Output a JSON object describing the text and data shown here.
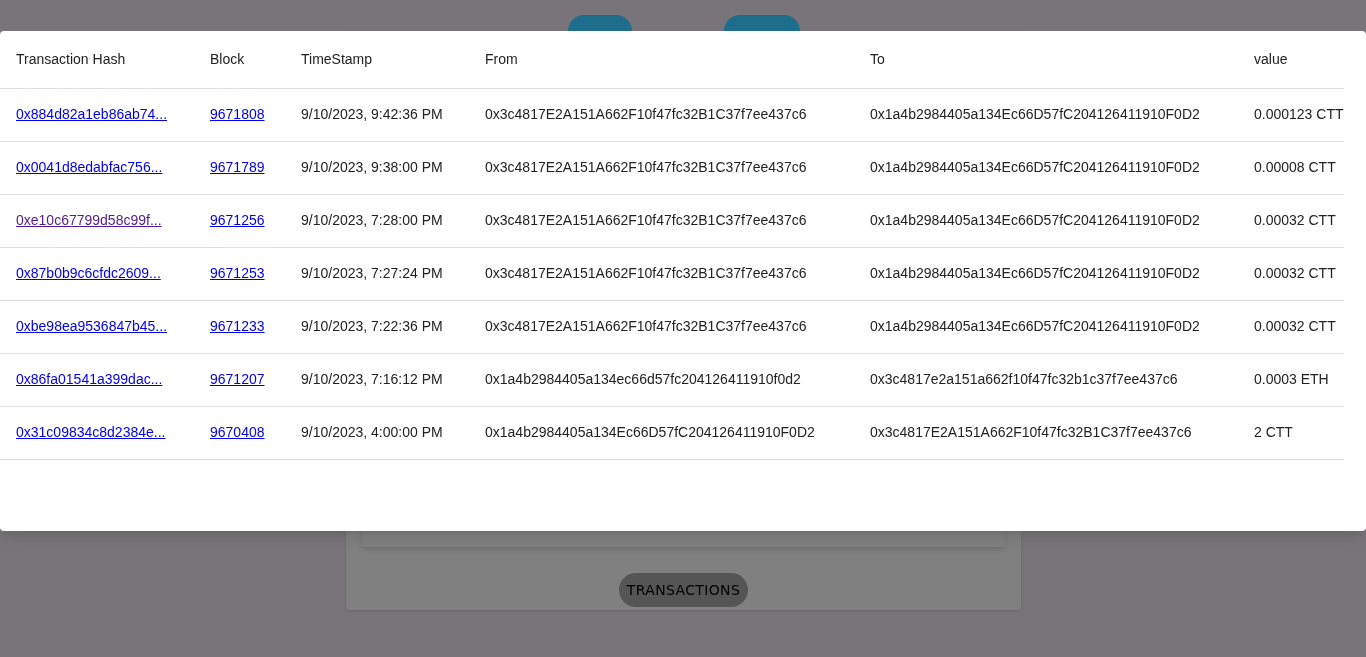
{
  "nav_buttons": [
    {
      "kind": "pill"
    },
    {
      "kind": "pill"
    }
  ],
  "table": {
    "columns": [
      "Transaction Hash",
      "Block",
      "TimeStamp",
      "From",
      "To",
      "value"
    ],
    "rows": [
      {
        "hash": "0x884d82a1eb86ab74...",
        "visited": false,
        "block": "9671808",
        "timestamp": "9/10/2023, 9:42:36 PM",
        "from": "0x3c4817E2A151A662F10f47fc32B1C37f7ee437c6",
        "to": "0x1a4b2984405a134Ec66D57fC204126411910F0D2",
        "value": "0.000123 CTT"
      },
      {
        "hash": "0x0041d8edabfac756...",
        "visited": false,
        "block": "9671789",
        "timestamp": "9/10/2023, 9:38:00 PM",
        "from": "0x3c4817E2A151A662F10f47fc32B1C37f7ee437c6",
        "to": "0x1a4b2984405a134Ec66D57fC204126411910F0D2",
        "value": "0.00008 CTT"
      },
      {
        "hash": "0xe10c67799d58c99f...",
        "visited": true,
        "block": "9671256",
        "timestamp": "9/10/2023, 7:28:00 PM",
        "from": "0x3c4817E2A151A662F10f47fc32B1C37f7ee437c6",
        "to": "0x1a4b2984405a134Ec66D57fC204126411910F0D2",
        "value": "0.00032 CTT"
      },
      {
        "hash": "0x87b0b9c6cfdc2609...",
        "visited": false,
        "block": "9671253",
        "timestamp": "9/10/2023, 7:27:24 PM",
        "from": "0x3c4817E2A151A662F10f47fc32B1C37f7ee437c6",
        "to": "0x1a4b2984405a134Ec66D57fC204126411910F0D2",
        "value": "0.00032 CTT"
      },
      {
        "hash": "0xbe98ea9536847b45...",
        "visited": false,
        "block": "9671233",
        "timestamp": "9/10/2023, 7:22:36 PM",
        "from": "0x3c4817E2A151A662F10f47fc32B1C37f7ee437c6",
        "to": "0x1a4b2984405a134Ec66D57fC204126411910F0D2",
        "value": "0.00032 CTT"
      },
      {
        "hash": "0x86fa01541a399dac...",
        "visited": false,
        "block": "9671207",
        "timestamp": "9/10/2023, 7:16:12 PM",
        "from": "0x1a4b2984405a134ec66d57fc204126411910f0d2",
        "to": "0x3c4817e2a151a662f10f47fc32b1c37f7ee437c6",
        "value": "0.0003 ETH"
      },
      {
        "hash": "0x31c09834c8d2384e...",
        "visited": false,
        "block": "9670408",
        "timestamp": "9/10/2023, 4:00:00 PM",
        "from": "0x1a4b2984405a134Ec66D57fC204126411910F0D2",
        "to": "0x3c4817E2A151A662F10f47fc32B1C37f7ee437c6",
        "value": "2 CTT"
      }
    ]
  },
  "transactions_button": "TRANSACTIONS"
}
